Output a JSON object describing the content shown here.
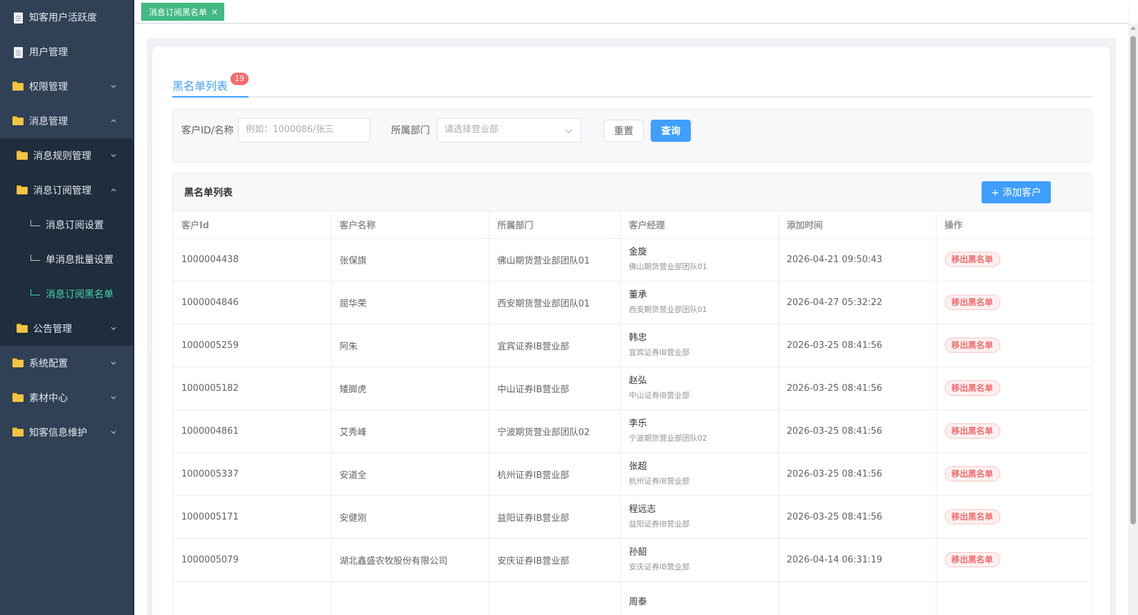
{
  "sidebar": {
    "items": [
      {
        "label": "知客用户活跃度",
        "icon": "document-icon",
        "level": 1
      },
      {
        "label": "用户管理",
        "icon": "document-icon",
        "level": 1
      },
      {
        "label": "权限管理",
        "icon": "folder-icon",
        "level": 1,
        "expand": "chevron-down-icon"
      },
      {
        "label": "消息管理",
        "icon": "folder-icon",
        "level": 1,
        "expand": "chevron-up-icon"
      },
      {
        "label": "消息规则管理",
        "icon": "folder-icon",
        "level": 2,
        "expand": "chevron-down-icon"
      },
      {
        "label": "消息订阅管理",
        "icon": "folder-icon",
        "level": 2,
        "expand": "chevron-up-icon"
      },
      {
        "label": "消息订阅设置",
        "level": 3
      },
      {
        "label": "单消息批量设置",
        "level": 3
      },
      {
        "label": "消息订阅黑名单",
        "level": 3,
        "active": true
      },
      {
        "label": "公告管理",
        "icon": "folder-icon",
        "level": 2,
        "expand": "chevron-down-icon"
      },
      {
        "label": "系统配置",
        "icon": "folder-icon",
        "level": 1,
        "expand": "chevron-down-icon"
      },
      {
        "label": "素材中心",
        "icon": "folder-icon",
        "level": 1,
        "expand": "chevron-down-icon"
      },
      {
        "label": "知客信息维护",
        "icon": "folder-icon",
        "level": 1,
        "expand": "chevron-down-icon"
      }
    ]
  },
  "tabs": {
    "active_tag": "消息订阅黑名单",
    "close_glyph": "×"
  },
  "page": {
    "tab_label": "黑名单列表",
    "tab_badge": "19"
  },
  "filter": {
    "customer_label": "客户ID/名称",
    "customer_placeholder": "例如：1000086/张三",
    "dept_label": "所属部门",
    "dept_placeholder": "请选择营业部",
    "reset_label": "重置",
    "query_label": "查询"
  },
  "list": {
    "title": "黑名单列表",
    "add_label": "+ 添加客户",
    "columns": [
      "客户Id",
      "客户名称",
      "所属部门",
      "客户经理",
      "添加时间",
      "操作"
    ],
    "action_label": "移出黑名单",
    "rows": [
      {
        "id": "1000004438",
        "name": "张保旗",
        "dept": "佛山期货营业部团队01",
        "manager": "金旋",
        "manager_dept": "佛山期货营业部团队01",
        "time": "2026-04-21 09:50:43"
      },
      {
        "id": "1000004846",
        "name": "屈华荣",
        "dept": "西安期货营业部团队01",
        "manager": "董承",
        "manager_dept": "西安期货营业部团队01",
        "time": "2026-04-27 05:32:22"
      },
      {
        "id": "1000005259",
        "name": "阿朱",
        "dept": "宜宾证券IB营业部",
        "manager": "韩忠",
        "manager_dept": "宜宾证券IB营业部",
        "time": "2026-03-25 08:41:56"
      },
      {
        "id": "1000005182",
        "name": "矮脚虎",
        "dept": "中山证券IB营业部",
        "manager": "赵弘",
        "manager_dept": "中山证券IB营业部",
        "time": "2026-03-25 08:41:56"
      },
      {
        "id": "1000004861",
        "name": "艾秀峰",
        "dept": "宁波期货营业部团队02",
        "manager": "李乐",
        "manager_dept": "宁波期货营业部团队02",
        "time": "2026-03-25 08:41:56"
      },
      {
        "id": "1000005337",
        "name": "安道全",
        "dept": "杭州证券IB营业部",
        "manager": "张超",
        "manager_dept": "杭州证券IB营业部",
        "time": "2026-03-25 08:41:56"
      },
      {
        "id": "1000005171",
        "name": "安健刚",
        "dept": "益阳证券IB营业部",
        "manager": "程远志",
        "manager_dept": "益阳证券IB营业部",
        "time": "2026-03-25 08:41:56"
      },
      {
        "id": "1000005079",
        "name": "湖北鑫盛农牧股份有限公司",
        "dept": "安庆证券IB营业部",
        "manager": "孙韶",
        "manager_dept": "安庆证券IB营业部",
        "time": "2026-04-14 06:31:19"
      },
      {
        "id": "",
        "name": "",
        "dept": "",
        "manager": "周泰",
        "manager_dept": "",
        "time": ""
      }
    ]
  },
  "colors": {
    "sidebar_bg": "#304156",
    "submenu_bg": "#1f2d3d",
    "active_green": "#48d6a6",
    "tag_green": "#42b983",
    "primary": "#409eff",
    "danger": "#f56c6c"
  }
}
